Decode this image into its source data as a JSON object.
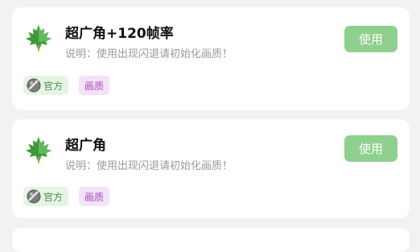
{
  "colors": {
    "button_bg": "#8fd08e",
    "official_tag_bg": "#e6f4e6",
    "official_tag_text": "#4c8f4c",
    "quality_tag_bg": "#f3e2f8",
    "quality_tag_text": "#a64fc0",
    "leaf_green": "#3b9a3b"
  },
  "items": [
    {
      "icon": "maple-leaf-icon",
      "title": "超广角+120帧率",
      "description": "说明：使用出现闪退请初始化画质！",
      "button_label": "使用",
      "tags": [
        {
          "icon": "globe-icon",
          "label": "官方"
        },
        {
          "label": "画质"
        }
      ]
    },
    {
      "icon": "maple-leaf-icon",
      "title": "超广角",
      "description": "说明：使用出现闪退请初始化画质！",
      "button_label": "使用",
      "tags": [
        {
          "icon": "globe-icon",
          "label": "官方"
        },
        {
          "label": "画质"
        }
      ]
    }
  ]
}
